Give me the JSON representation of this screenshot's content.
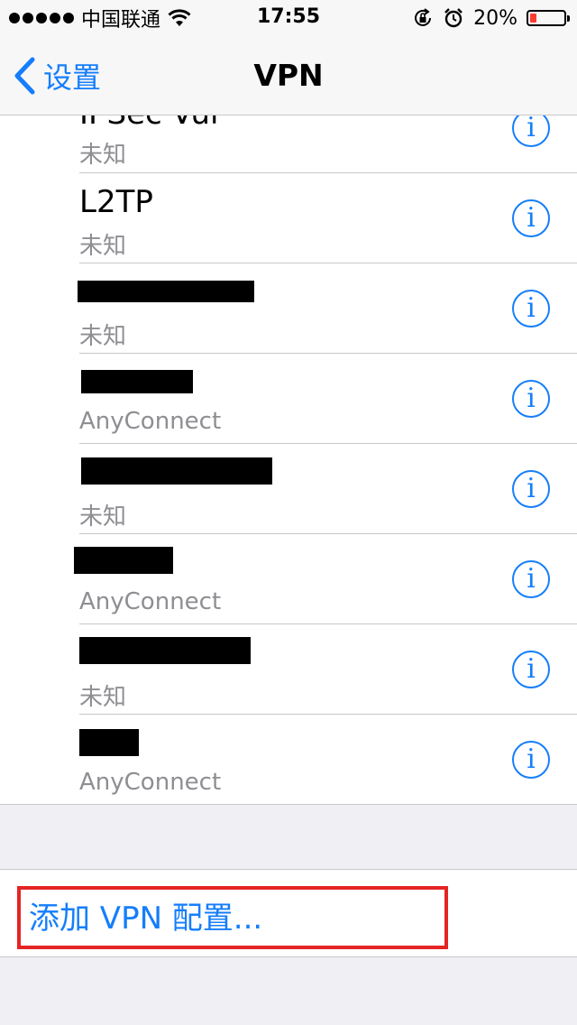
{
  "status_bar": {
    "carrier": "中国联通",
    "time": "17:55",
    "battery_percent": "20%",
    "battery_level": 0.2,
    "icons": [
      "signal-dots",
      "wifi-icon",
      "rotation-lock-icon",
      "alarm-icon",
      "battery-icon"
    ]
  },
  "nav": {
    "back_label": "设置",
    "title": "VPN"
  },
  "vpn_list": [
    {
      "name": "IPSec Vul",
      "type": "未知"
    },
    {
      "name": "L2TP",
      "type": "未知"
    },
    {
      "name": "",
      "type": "未知",
      "redacted": true
    },
    {
      "name": "",
      "type": "AnyConnect",
      "redacted": true
    },
    {
      "name": "",
      "type": "未知",
      "redacted": true
    },
    {
      "name": "",
      "type": "AnyConnect",
      "redacted": true
    },
    {
      "name": "",
      "type": "未知",
      "redacted": true
    },
    {
      "name": "",
      "type": "AnyConnect",
      "redacted": true
    }
  ],
  "info_glyph": "i",
  "add_vpn": {
    "label": "添加 VPN 配置..."
  },
  "colors": {
    "accent": "#157efb",
    "highlight": "#e52424",
    "battery_low": "#ff3b30",
    "secondary_text": "#8e8e93",
    "background": "#efeff4"
  }
}
